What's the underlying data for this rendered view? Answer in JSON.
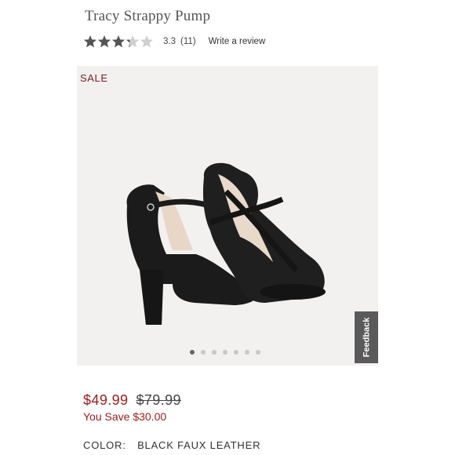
{
  "product": {
    "title": "Tracy Strappy Pump",
    "rating": {
      "value": 3.3,
      "value_text": "3.3",
      "count_text": "(11)",
      "max_stars": 5,
      "write_review_label": "Write a review"
    },
    "badge": "SALE",
    "gallery": {
      "image_icon": "black-strappy-pumps-image",
      "feedback_label": "Feedback",
      "dot_count": 7,
      "active_dot": 1
    },
    "price": {
      "sale": "$49.99",
      "original": "$79.99",
      "you_save": "You Save $30.00"
    },
    "color": {
      "label": "COLOR:",
      "value": "BLACK FAUX LEATHER"
    }
  },
  "colors": {
    "sale_red": "#9e1b1b",
    "sale_badge": "#7a1e1e",
    "star_filled": "#555555",
    "star_empty": "#cfcfcf",
    "gallery_bg": "#f2f1ef"
  }
}
